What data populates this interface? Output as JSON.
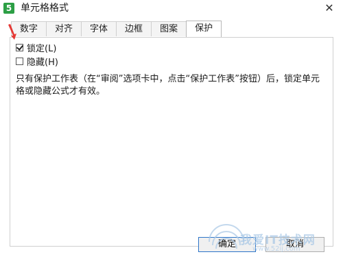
{
  "window": {
    "title": "单元格格式",
    "app_icon_glyph": "5",
    "close_glyph": "✕"
  },
  "tabs": [
    {
      "label": "数字",
      "active": false
    },
    {
      "label": "对齐",
      "active": false
    },
    {
      "label": "字体",
      "active": false
    },
    {
      "label": "边框",
      "active": false
    },
    {
      "label": "图案",
      "active": false
    },
    {
      "label": "保护",
      "active": true
    }
  ],
  "protection": {
    "locked_label": "锁定(L)",
    "locked_checked": true,
    "hidden_label": "隐藏(H)",
    "hidden_checked": false,
    "note": "只有保护工作表（在“审阅”选项卡中，点击“保护工作表”按钮）后，锁定单元格或隐藏公式才有效。"
  },
  "buttons": {
    "ok_label": "确定",
    "cancel_label": "取消"
  },
  "watermark": {
    "text": "我爱IT技术网",
    "sub": "www.52ij.com"
  },
  "colors": {
    "arrow": "#e53935",
    "accent": "#2b73c8",
    "app_icon": "#2c9f45"
  }
}
